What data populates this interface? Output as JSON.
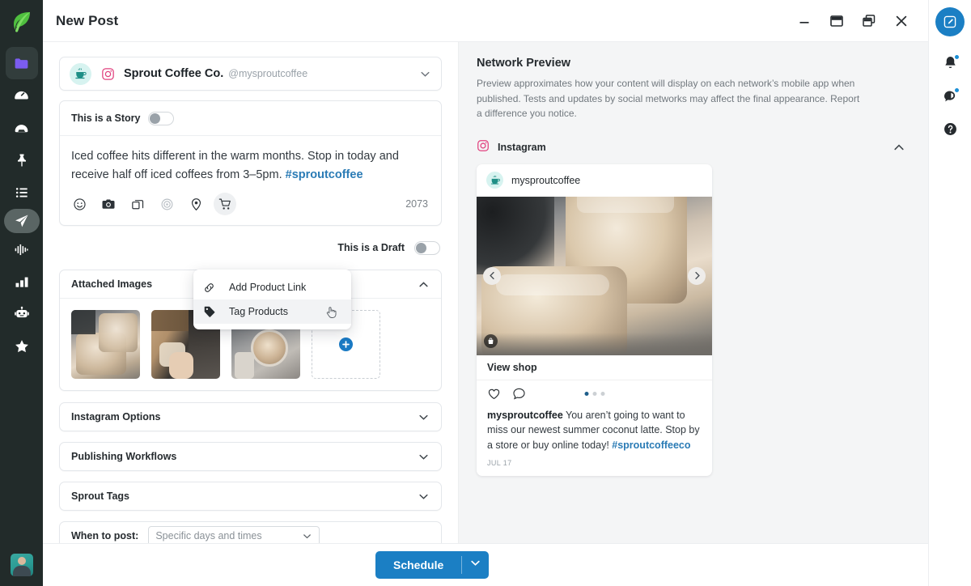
{
  "window": {
    "title": "New Post",
    "controls": [
      {
        "name": "minimize",
        "glyph": "minimize-icon"
      },
      {
        "name": "maximize",
        "glyph": "maximize-icon"
      },
      {
        "name": "restore",
        "glyph": "restore-icon"
      },
      {
        "name": "close",
        "glyph": "close-icon"
      }
    ]
  },
  "left_rail": {
    "logo": "sprout-leaf-logo",
    "items": [
      {
        "name": "publishing-folder",
        "icon": "folder-icon",
        "state": "boxed"
      },
      {
        "name": "dashboard",
        "icon": "speedometer-icon",
        "state": "normal"
      },
      {
        "name": "inbox",
        "icon": "inbox-icon",
        "state": "normal"
      },
      {
        "name": "pin",
        "icon": "pin-icon",
        "state": "normal"
      },
      {
        "name": "tasks",
        "icon": "list-icon",
        "state": "normal"
      },
      {
        "name": "publish",
        "icon": "paper-plane-icon",
        "state": "active"
      },
      {
        "name": "listening",
        "icon": "waveform-icon",
        "state": "normal"
      },
      {
        "name": "reports",
        "icon": "bar-chart-icon",
        "state": "normal"
      },
      {
        "name": "bot",
        "icon": "robot-icon",
        "state": "normal"
      },
      {
        "name": "reviews",
        "icon": "star-icon",
        "state": "normal"
      }
    ],
    "avatar": "user-avatar"
  },
  "right_rail": {
    "compose_label": "compose-icon",
    "items": [
      {
        "name": "notifications",
        "icon": "bell-icon",
        "badge": true
      },
      {
        "name": "messages",
        "icon": "message-flag-icon",
        "badge": true
      },
      {
        "name": "help",
        "icon": "help-icon",
        "badge": false
      }
    ]
  },
  "composer": {
    "profile": {
      "avatar": "coffee-cup-avatar",
      "network_icon": "instagram-icon",
      "name": "Sprout Coffee Co.",
      "handle": "@mysproutcoffee",
      "caret": "chevron-down-icon"
    },
    "story_toggle": {
      "label": "This is a Story",
      "on": false
    },
    "message": {
      "text": "Iced coffee hits different in the warm months. Stop in today and receive half off iced coffees from 3–5pm. ",
      "hashtag": "#sproutcoffee"
    },
    "tools": [
      {
        "name": "emoji",
        "icon": "emoji-icon",
        "state": "normal"
      },
      {
        "name": "media",
        "icon": "camera-icon",
        "state": "normal"
      },
      {
        "name": "duplicate",
        "icon": "layers-icon",
        "state": "normal"
      },
      {
        "name": "target",
        "icon": "target-icon",
        "state": "muted"
      },
      {
        "name": "location",
        "icon": "location-pin-icon",
        "state": "normal"
      },
      {
        "name": "shopping",
        "icon": "shopping-cart-icon",
        "state": "active"
      }
    ],
    "character_count": "2073",
    "draft_toggle": {
      "label": "This is a Draft",
      "on": false
    },
    "attached_images": {
      "title": "Attached Images",
      "caret": "chevron-up-icon",
      "thumbnails": [
        {
          "name": "iced-coffee-cups-photo"
        },
        {
          "name": "person-holding-iced-coffee-photo"
        },
        {
          "name": "iced-coffee-overhead-photo"
        }
      ],
      "add_label": "add-image-button"
    },
    "sections": [
      {
        "name": "instagram-options",
        "title": "Instagram Options",
        "caret": "chevron-down-icon"
      },
      {
        "name": "publishing-workflows",
        "title": "Publishing Workflows",
        "caret": "chevron-down-icon"
      },
      {
        "name": "sprout-tags",
        "title": "Sprout Tags",
        "caret": "chevron-down-icon"
      }
    ],
    "when_to_post": {
      "label": "When to post:",
      "value": "Specific days and times",
      "caret": "chevron-down-icon"
    }
  },
  "popover": {
    "items": [
      {
        "name": "add-product-link",
        "icon": "link-icon",
        "label": "Add Product Link",
        "hover": false
      },
      {
        "name": "tag-products",
        "icon": "tag-icon",
        "label": "Tag Products",
        "hover": true
      }
    ],
    "cursor": "pointer-hand-cursor"
  },
  "preview": {
    "title": "Network Preview",
    "description": "Preview approximates how your content will display on each network’s mobile app when published. Tests and updates by social metworks may affect the final appearance. Report a difference you notice.",
    "network": {
      "icon": "instagram-icon",
      "name": "Instagram",
      "caret": "chevron-up-icon"
    },
    "post": {
      "avatar": "coffee-cup-avatar",
      "username": "mysproutcoffee",
      "media": "iced-coffee-cups-photo",
      "prev_label": "carousel-prev-icon",
      "next_label": "carousel-next-icon",
      "shop_badge": "shopping-bag-icon",
      "view_shop": "View shop",
      "actions": [
        {
          "name": "like",
          "icon": "heart-icon"
        },
        {
          "name": "comment",
          "icon": "comment-icon"
        }
      ],
      "dots": [
        true,
        false,
        false
      ],
      "caption_author": "mysproutcoffee",
      "caption_text": " You aren’t going to want to miss our newest summer coconut latte. Stop by a store or buy online today! ",
      "caption_hashtag": "#sproutcoffeeco",
      "date": "JUL 17"
    }
  },
  "footer": {
    "schedule_label": "Schedule",
    "schedule_caret": "chevron-down-icon"
  },
  "colors": {
    "accent_blue": "#1b7fc4",
    "link_blue": "#2a7bb5",
    "rail_dark": "#222b2a",
    "preview_bg": "#f4f5f6",
    "leaf_green": "#59c34a"
  }
}
